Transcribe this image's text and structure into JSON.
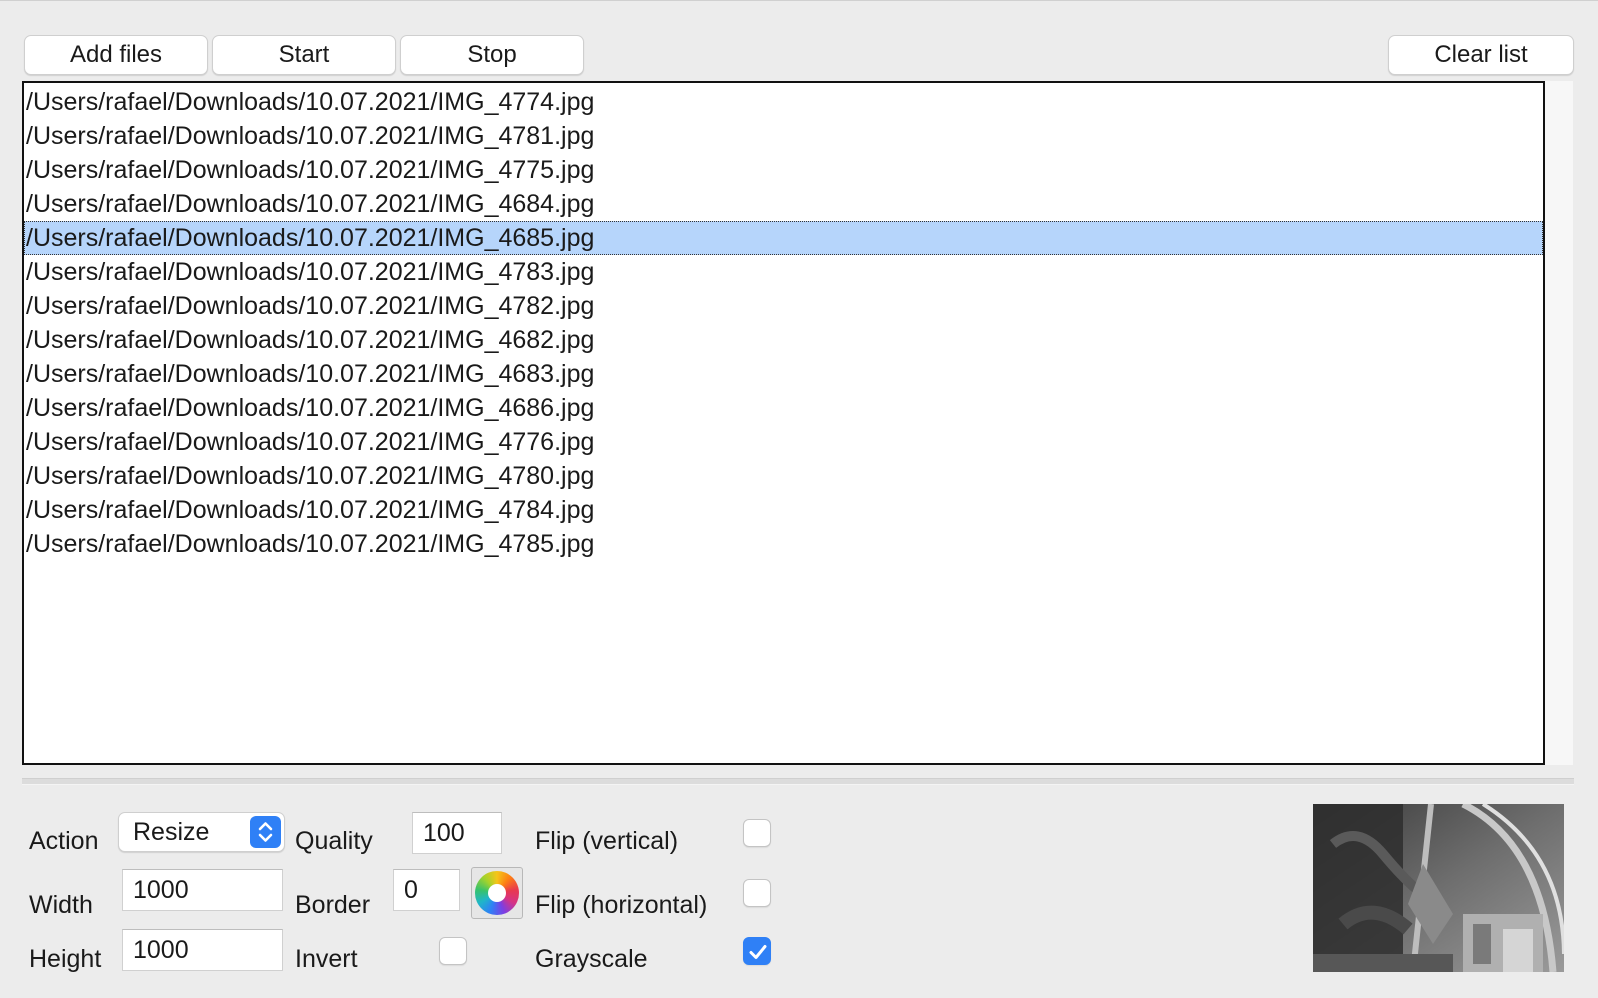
{
  "toolbar": {
    "add_files_label": "Add files",
    "start_label": "Start",
    "stop_label": "Stop",
    "clear_list_label": "Clear list"
  },
  "file_list": {
    "items": [
      "/Users/rafael/Downloads/10.07.2021/IMG_4774.jpg",
      "/Users/rafael/Downloads/10.07.2021/IMG_4781.jpg",
      "/Users/rafael/Downloads/10.07.2021/IMG_4775.jpg",
      "/Users/rafael/Downloads/10.07.2021/IMG_4684.jpg",
      "/Users/rafael/Downloads/10.07.2021/IMG_4685.jpg",
      "/Users/rafael/Downloads/10.07.2021/IMG_4783.jpg",
      "/Users/rafael/Downloads/10.07.2021/IMG_4782.jpg",
      "/Users/rafael/Downloads/10.07.2021/IMG_4682.jpg",
      "/Users/rafael/Downloads/10.07.2021/IMG_4683.jpg",
      "/Users/rafael/Downloads/10.07.2021/IMG_4686.jpg",
      "/Users/rafael/Downloads/10.07.2021/IMG_4776.jpg",
      "/Users/rafael/Downloads/10.07.2021/IMG_4780.jpg",
      "/Users/rafael/Downloads/10.07.2021/IMG_4784.jpg",
      "/Users/rafael/Downloads/10.07.2021/IMG_4785.jpg"
    ],
    "selected_index": 4,
    "selection_color": "#b6d5fb"
  },
  "settings": {
    "action_label": "Action",
    "action_value": "Resize",
    "width_label": "Width",
    "width_value": "1000",
    "height_label": "Height",
    "height_value": "1000",
    "quality_label": "Quality",
    "quality_value": "100",
    "border_label": "Border",
    "border_value": "0",
    "invert_label": "Invert",
    "invert_checked": false,
    "flip_vertical_label": "Flip (vertical)",
    "flip_vertical_checked": false,
    "flip_horizontal_label": "Flip (horizontal)",
    "flip_horizontal_checked": false,
    "grayscale_label": "Grayscale",
    "grayscale_checked": true
  },
  "colors": {
    "accent": "#2f80f6",
    "window_bg": "#ececec"
  },
  "icons": {
    "select_arrows": "chevron-up-down-icon",
    "checkmark": "checkmark-icon",
    "color_picker": "color-wheel-icon"
  }
}
